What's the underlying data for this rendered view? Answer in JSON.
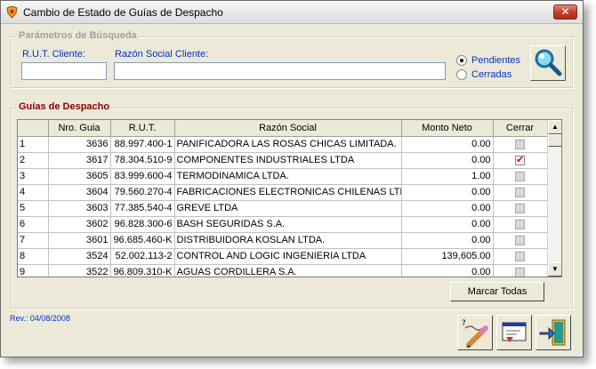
{
  "window": {
    "title": "Cambio de Estado de Guías de Despacho",
    "close_label": "✕"
  },
  "search": {
    "legend": "Parámetros de Búsqueda",
    "rut_label": "R.U.T. Cliente:",
    "rut_value": "",
    "razon_label": "Razón Social Cliente:",
    "razon_value": "",
    "radio_pendientes": "Pendientes",
    "radio_cerradas": "Cerradas",
    "selected": "Pendientes"
  },
  "grid": {
    "legend": "Guías de Despacho",
    "headers": [
      "",
      "Nro. Guia",
      "R.U.T.",
      "Razón Social",
      "Monto Neto",
      "Cerrar"
    ],
    "rows": [
      {
        "n": "1",
        "guia": "3636",
        "rut": "88.997.400-1",
        "razon": "PANIFICADORA LAS ROSAS CHICAS LIMITADA.",
        "monto": "0.00",
        "cerrar": false
      },
      {
        "n": "2",
        "guia": "3617",
        "rut": "78.304.510-9",
        "razon": "COMPONENTES INDUSTRIALES LTDA",
        "monto": "0.00",
        "cerrar": true
      },
      {
        "n": "3",
        "guia": "3605",
        "rut": "83.999.600-4",
        "razon": "TERMODINAMICA LTDA.",
        "monto": "1.00",
        "cerrar": false
      },
      {
        "n": "4",
        "guia": "3604",
        "rut": "79.560.270-4",
        "razon": "FABRICACIONES ELECTRONICAS CHILENAS LTDA",
        "monto": "0.00",
        "cerrar": false
      },
      {
        "n": "5",
        "guia": "3603",
        "rut": "77.385.540-4",
        "razon": "GREVE LTDA",
        "monto": "0.00",
        "cerrar": false
      },
      {
        "n": "6",
        "guia": "3602",
        "rut": "96.828.300-6",
        "razon": "BASH SEGURIDAS S.A.",
        "monto": "0.00",
        "cerrar": false
      },
      {
        "n": "7",
        "guia": "3601",
        "rut": "96.685.460-K",
        "razon": "DISTRIBUIDORA KOSLAN LTDA.",
        "monto": "0.00",
        "cerrar": false
      },
      {
        "n": "8",
        "guia": "3524",
        "rut": "52.002.113-2",
        "razon": "CONTROL AND LOGIC INGENIERIA LTDA",
        "monto": "139,605.00",
        "cerrar": false
      },
      {
        "n": "9",
        "guia": "3522",
        "rut": "96.809.310-K",
        "razon": "AGUAS CORDILLERA S.A.",
        "monto": "0.00",
        "cerrar": false
      }
    ]
  },
  "buttons": {
    "marcar_todas": "Marcar Todas"
  },
  "footer": {
    "revision": "Rev.: 04/08/2008"
  },
  "icons": {
    "app": "shield-icon",
    "search": "magnifier-icon",
    "edit": "pen-edit-icon",
    "report": "report-window-icon",
    "exit": "exit-door-icon"
  }
}
